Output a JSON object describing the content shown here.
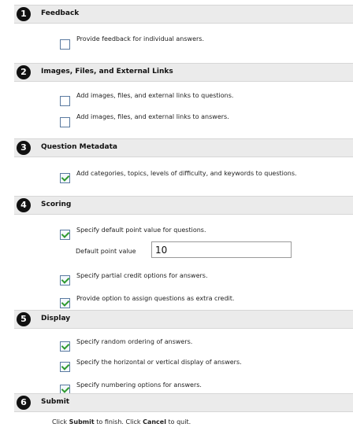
{
  "sections": [
    {
      "number": "1",
      "title": "Feedback",
      "options": [
        {
          "label": "Provide feedback for individual answers.",
          "checked": false
        }
      ]
    },
    {
      "number": "2",
      "title": "Images, Files, and External Links",
      "options": [
        {
          "label": "Add images, files, and external links to questions.",
          "checked": false
        },
        {
          "label": "Add images, files, and external links to answers.",
          "checked": false
        }
      ]
    },
    {
      "number": "3",
      "title": "Question Metadata",
      "options": [
        {
          "label": "Add categories, topics, levels of difficulty, and keywords to questions.",
          "checked": true
        }
      ]
    },
    {
      "number": "4",
      "title": "Scoring",
      "options": [
        {
          "label": "Specify default point value for questions.",
          "checked": true
        },
        {
          "label": "Specify partial credit options for answers.",
          "checked": true
        },
        {
          "label": "Provide option to assign questions as extra credit.",
          "checked": true
        }
      ],
      "default_point_label": "Default point value",
      "default_point_value": "10"
    },
    {
      "number": "5",
      "title": "Display",
      "options": [
        {
          "label": "Specify random ordering of answers.",
          "checked": true
        },
        {
          "label": "Specify the horizontal or vertical display of answers.",
          "checked": true
        },
        {
          "label": "Specify numbering options for answers.",
          "checked": true
        }
      ]
    },
    {
      "number": "6",
      "title": "Submit",
      "options": []
    }
  ],
  "submit_text": {
    "part1": "Click ",
    "submit": "Submit",
    "part2": " to finish. Click ",
    "cancel": "Cancel",
    "part3": " to quit."
  },
  "colors": {
    "header_bg": "#ebebeb",
    "check": "#2f9a2f",
    "checkbox_border": "#5a7aa0"
  }
}
